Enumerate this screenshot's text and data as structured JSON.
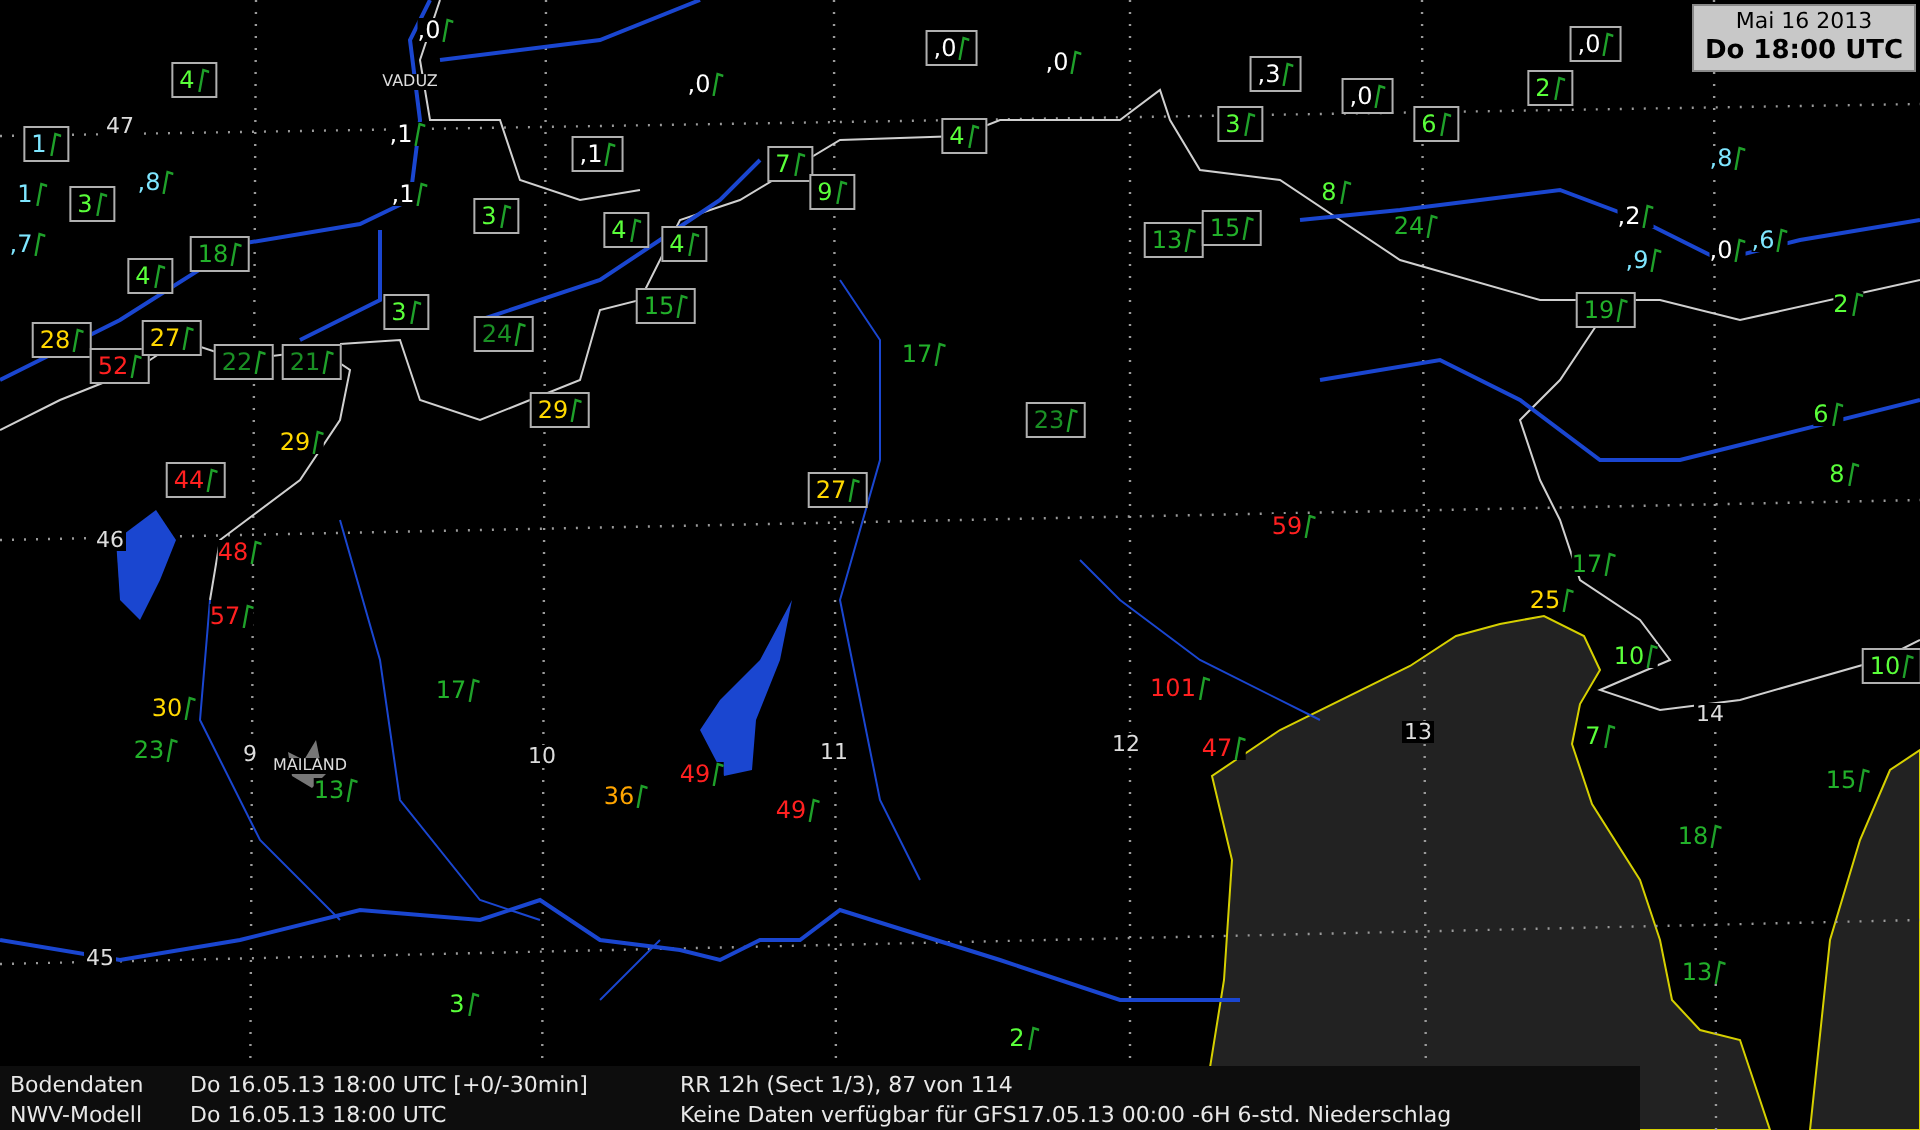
{
  "time_box": {
    "date": "Mai 16 2013",
    "time": "Do 18:00 UTC"
  },
  "city_labels": [
    "VADUZ",
    "MAILAND"
  ],
  "grid_labels": [
    "47",
    "46",
    "45",
    "9",
    "10",
    "11",
    "12",
    "13",
    "14"
  ],
  "stations": [
    {
      "value": "4",
      "color": "#5aff3a",
      "boxed": true
    },
    {
      "value": ",0",
      "color": "#ffffff",
      "boxed": false
    },
    {
      "value": "1",
      "color": "#7fe6ff",
      "boxed": true
    },
    {
      "value": "1",
      "color": "#7fe6ff",
      "boxed": false
    },
    {
      "value": "3",
      "color": "#5aff3a",
      "boxed": true
    },
    {
      "value": ",8",
      "color": "#7fe6ff",
      "boxed": false
    },
    {
      "value": ",7",
      "color": "#7fe6ff",
      "boxed": false
    },
    {
      "value": "4",
      "color": "#5aff3a",
      "boxed": true
    },
    {
      "value": "18",
      "color": "#22b02a",
      "boxed": true
    },
    {
      "value": "28",
      "color": "#ffd800",
      "boxed": true
    },
    {
      "value": "52",
      "color": "#ff2020",
      "boxed": true
    },
    {
      "value": "27",
      "color": "#ffd800",
      "boxed": true
    },
    {
      "value": "22",
      "color": "#1a8f24",
      "boxed": true
    },
    {
      "value": "21",
      "color": "#1a8f24",
      "boxed": true
    },
    {
      "value": ",1",
      "color": "#ffffff",
      "boxed": false
    },
    {
      "value": ",1",
      "color": "#ffffff",
      "boxed": false
    },
    {
      "value": "3",
      "color": "#5aff3a",
      "boxed": true
    },
    {
      "value": "3",
      "color": "#5aff3a",
      "boxed": true
    },
    {
      "value": "24",
      "color": "#1a8f24",
      "boxed": true
    },
    {
      "value": "29",
      "color": "#ffd800",
      "boxed": true
    },
    {
      "value": "29",
      "color": "#ffd800",
      "boxed": false
    },
    {
      "value": "44",
      "color": "#ff2020",
      "boxed": true
    },
    {
      "value": "48",
      "color": "#ff2020",
      "boxed": false
    },
    {
      "value": ",1",
      "color": "#ffffff",
      "boxed": true
    },
    {
      "value": "4",
      "color": "#5aff3a",
      "boxed": true
    },
    {
      "value": ",0",
      "color": "#ffffff",
      "boxed": false
    },
    {
      "value": ",0",
      "color": "#ffffff",
      "boxed": true
    },
    {
      "value": ",0",
      "color": "#ffffff",
      "boxed": false
    },
    {
      "value": "4",
      "color": "#5aff3a",
      "boxed": true
    },
    {
      "value": "15",
      "color": "#22b02a",
      "boxed": true
    },
    {
      "value": "7",
      "color": "#5aff3a",
      "boxed": true
    },
    {
      "value": "9",
      "color": "#5aff3a",
      "boxed": true
    },
    {
      "value": "4",
      "color": "#5aff3a",
      "boxed": true
    },
    {
      "value": "17",
      "color": "#22b02a",
      "boxed": false
    },
    {
      "value": "23",
      "color": "#1a8f24",
      "boxed": true
    },
    {
      "value": "27",
      "color": "#ffd800",
      "boxed": true
    },
    {
      "value": "3",
      "color": "#5aff3a",
      "boxed": true
    },
    {
      "value": "13",
      "color": "#22b02a",
      "boxed": true
    },
    {
      "value": "15",
      "color": "#22b02a",
      "boxed": true
    },
    {
      "value": ",3",
      "color": "#ffffff",
      "boxed": true
    },
    {
      "value": ",0",
      "color": "#ffffff",
      "boxed": true
    },
    {
      "value": "6",
      "color": "#5aff3a",
      "boxed": true
    },
    {
      "value": "2",
      "color": "#5aff3a",
      "boxed": true
    },
    {
      "value": ",0",
      "color": "#ffffff",
      "boxed": true
    },
    {
      "value": "8",
      "color": "#5aff3a",
      "boxed": false
    },
    {
      "value": "24",
      "color": "#22b02a",
      "boxed": false
    },
    {
      "value": ",2",
      "color": "#ffffff",
      "boxed": false
    },
    {
      "value": ",8",
      "color": "#7fe6ff",
      "boxed": false
    },
    {
      "value": ",9",
      "color": "#7fe6ff",
      "boxed": false
    },
    {
      "value": ",0",
      "color": "#ffffff",
      "boxed": false
    },
    {
      "value": ",6",
      "color": "#7fe6ff",
      "boxed": false
    },
    {
      "value": "19",
      "color": "#22b02a",
      "boxed": true
    },
    {
      "value": "2",
      "color": "#5aff3a",
      "boxed": false
    },
    {
      "value": "6",
      "color": "#5aff3a",
      "boxed": false
    },
    {
      "value": "8",
      "color": "#5aff3a",
      "boxed": false
    },
    {
      "value": "59",
      "color": "#ff2020",
      "boxed": false
    },
    {
      "value": "17",
      "color": "#22b02a",
      "boxed": false
    },
    {
      "value": "57",
      "color": "#ff2020",
      "boxed": false
    },
    {
      "value": "30",
      "color": "#ffd800",
      "boxed": false
    },
    {
      "value": "23",
      "color": "#22b02a",
      "boxed": false
    },
    {
      "value": "13",
      "color": "#22b02a",
      "boxed": false
    },
    {
      "value": "17",
      "color": "#22b02a",
      "boxed": false
    },
    {
      "value": "36",
      "color": "#ffa500",
      "boxed": false
    },
    {
      "value": "49",
      "color": "#ff2020",
      "boxed": false
    },
    {
      "value": "49",
      "color": "#ff2020",
      "boxed": false
    },
    {
      "value": "3",
      "color": "#5aff3a",
      "boxed": false
    },
    {
      "value": "101",
      "color": "#ff2020",
      "boxed": false
    },
    {
      "value": "47",
      "color": "#ff2020",
      "boxed": false
    },
    {
      "value": "25",
      "color": "#ffd800",
      "boxed": false
    },
    {
      "value": "10",
      "color": "#5aff3a",
      "boxed": false
    },
    {
      "value": "10",
      "color": "#5aff3a",
      "boxed": true
    },
    {
      "value": "7",
      "color": "#5aff3a",
      "boxed": false
    },
    {
      "value": "15",
      "color": "#22b02a",
      "boxed": false
    },
    {
      "value": "18",
      "color": "#22b02a",
      "boxed": false
    },
    {
      "value": "13",
      "color": "#22b02a",
      "boxed": false
    },
    {
      "value": "2",
      "color": "#5aff3a",
      "boxed": false
    }
  ],
  "footer": [
    {
      "label": "Bodendaten",
      "time": "Do 16.05.13 18:00 UTC [+0/-30min]",
      "info": "RR 12h (Sect 1/3), 87 von 114"
    },
    {
      "label": "NWV-Modell",
      "time": "Do 16.05.13 18:00 UTC",
      "info": "Keine Daten verfügbar für GFS17.05.13 00:00 -6H 6-std. Niederschlag"
    }
  ]
}
